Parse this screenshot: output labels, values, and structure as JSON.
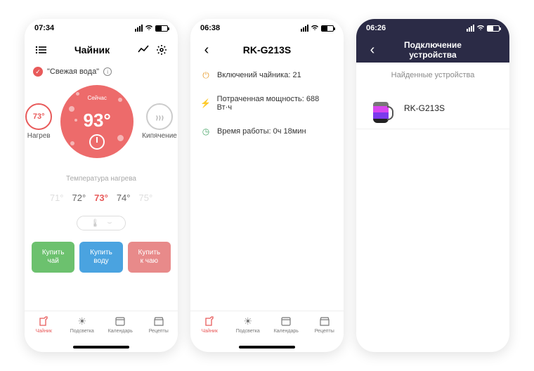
{
  "phone1": {
    "time": "07:34",
    "title": "Чайник",
    "fresh_water": "\"Свежая вода\"",
    "side_left_temp": "73°",
    "side_left_label": "Нагрев",
    "side_right_label": "Кипячение",
    "now_label": "Сейчас",
    "current_temp": "93°",
    "section_label": "Температура нагрева",
    "temps": {
      "t0": "71°",
      "t1": "72°",
      "t2": "73°",
      "t3": "74°",
      "t4": "75°"
    },
    "buy": {
      "tea": "Купить\nчай",
      "water": "Купить\nводу",
      "for_tea": "Купить\nк чаю"
    }
  },
  "phone2": {
    "time": "06:38",
    "title": "RK-G213S",
    "stat_power": "Включений чайника: 21",
    "stat_energy": "Потраченная мощность: 688 Вт·ч",
    "stat_time": "Время работы: 0ч 18мин"
  },
  "phone3": {
    "time": "06:26",
    "title": "Подключение устройства",
    "found_label": "Найденные устройства",
    "device_name": "RK-G213S"
  },
  "tabs": {
    "kettle": "Чайник",
    "light": "Подсветка",
    "calendar": "Календарь",
    "recipes": "Рецепты"
  }
}
